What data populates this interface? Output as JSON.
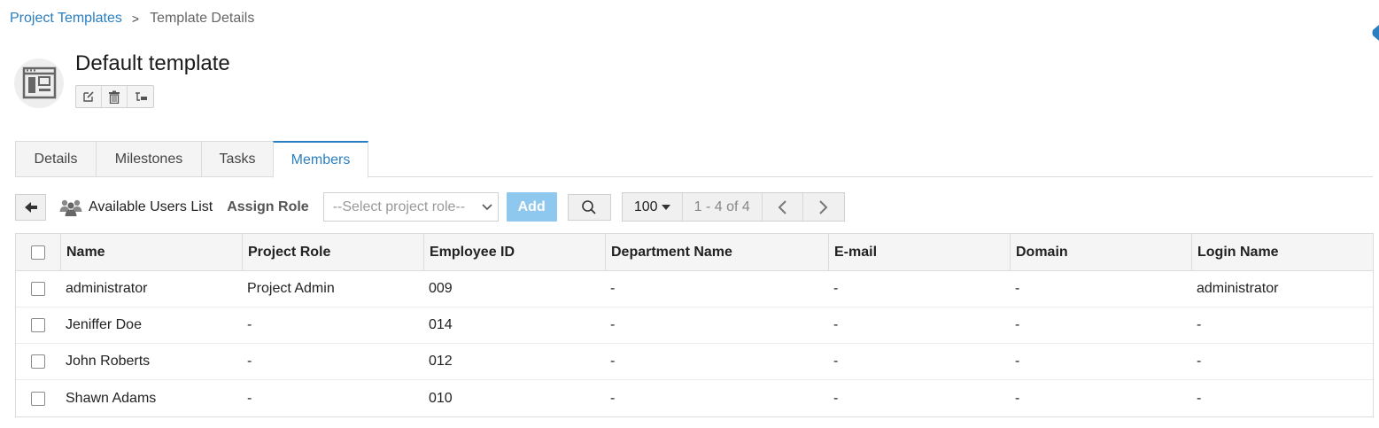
{
  "breadcrumb": {
    "parent": "Project Templates",
    "separator": ">",
    "current": "Template Details"
  },
  "header": {
    "title": "Default template",
    "icons": [
      "template-icon",
      "edit-icon",
      "delete-icon",
      "hierarchy-icon"
    ]
  },
  "tabs": [
    {
      "label": "Details",
      "active": false
    },
    {
      "label": "Milestones",
      "active": false
    },
    {
      "label": "Tasks",
      "active": false
    },
    {
      "label": "Members",
      "active": true
    }
  ],
  "toolbar": {
    "available_users_label": "Available Users List",
    "assign_role_label": "Assign Role",
    "role_placeholder": "--Select project role--",
    "add_label": "Add",
    "per_page": "100",
    "range": "1 - 4 of 4",
    "accent_color": "#8ec8ef"
  },
  "table": {
    "columns": [
      "Name",
      "Project Role",
      "Employee ID",
      "Department Name",
      "E-mail",
      "Domain",
      "Login Name"
    ],
    "rows": [
      {
        "name": "administrator",
        "role": "Project Admin",
        "employee_id": "009",
        "department": "-",
        "email": "-",
        "domain": "-",
        "login": "administrator"
      },
      {
        "name": "Jeniffer Doe",
        "role": "-",
        "employee_id": "014",
        "department": "-",
        "email": "-",
        "domain": "-",
        "login": "-"
      },
      {
        "name": "John Roberts",
        "role": "-",
        "employee_id": "012",
        "department": "-",
        "email": "-",
        "domain": "-",
        "login": "-"
      },
      {
        "name": "Shawn Adams",
        "role": "-",
        "employee_id": "010",
        "department": "-",
        "email": "-",
        "domain": "-",
        "login": "-"
      }
    ]
  },
  "colors": {
    "link": "#2a7fc1",
    "active_tab": "#2a7fc1"
  }
}
